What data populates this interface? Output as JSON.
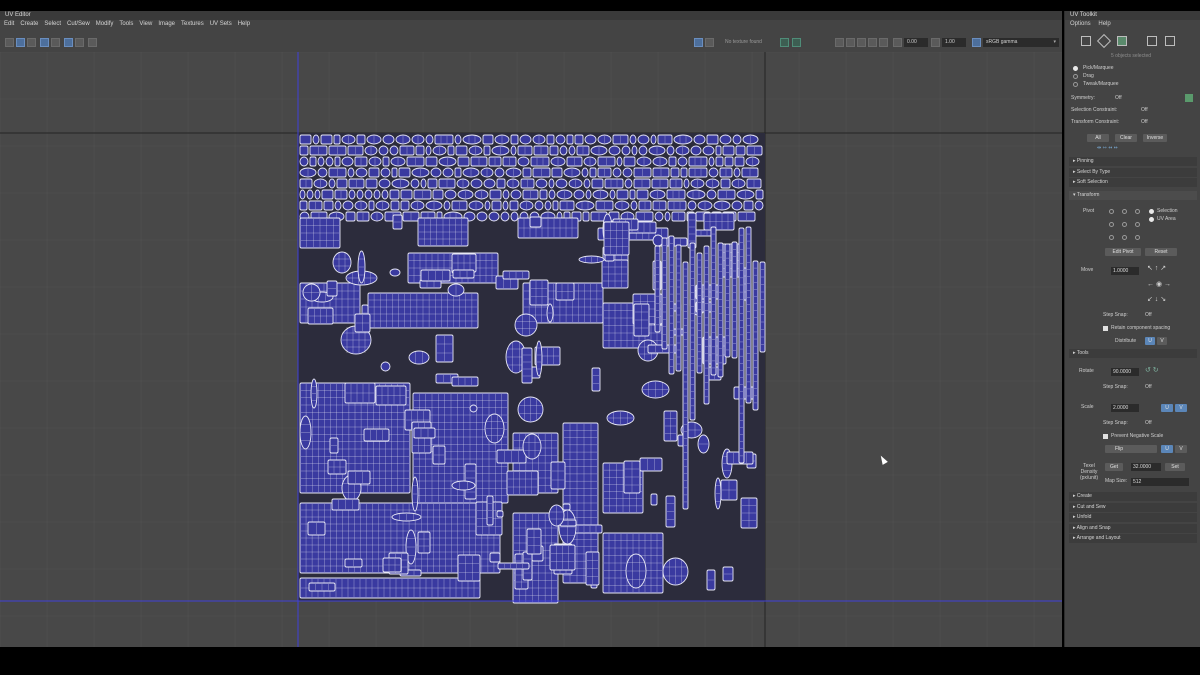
{
  "editor": {
    "title": "UV Editor",
    "menus": [
      "Edit",
      "Create",
      "Select",
      "Cut/Sew",
      "Modify",
      "Tools",
      "View",
      "Image",
      "Textures",
      "UV Sets",
      "Help"
    ],
    "toolbar": {
      "texture_status": "No texture found",
      "exposure": "0.00",
      "gamma": "1.00",
      "color_space": "sRGB gamma"
    },
    "viewport": {
      "axis_color": "#4040d8",
      "uv_fill": "#3a3aa0",
      "uv_line": "#e8e8f5"
    }
  },
  "toolkit": {
    "title": "UV Toolkit",
    "menus": [
      "Options",
      "Help"
    ],
    "objects_selected": "5 objects selected",
    "selection_modes": [
      "Pick/Marquee",
      "Drag",
      "Tweak/Marquee"
    ],
    "symmetry": {
      "label": "Symmetry:",
      "value": "Off"
    },
    "selection_constraint": {
      "label": "Selection Constraint:",
      "value": "Off"
    },
    "transform_constraint": {
      "label": "Transform Constraint:",
      "value": "Off"
    },
    "select_buttons": [
      "All",
      "Clear",
      "Inverse"
    ],
    "sections_top": [
      "Pinning",
      "Select By Type",
      "Soft Selection"
    ],
    "transform": {
      "header": "Transform",
      "pivot_label": "Pivot",
      "pivot_options": [
        "Selection",
        "UV Area"
      ],
      "edit_pivot": "Edit Pivot",
      "reset": "Reset",
      "move_label": "Move",
      "move_value": "1.0000",
      "step_snap_label": "Step Snap:",
      "step_snap_value": "Off",
      "retain_spacing": "Retain component spacing",
      "distribute": "Distribute",
      "u": "U",
      "v": "V",
      "tools": "Tools",
      "rotate_label": "Rotate",
      "rotate_value": "90.0000",
      "scale_label": "Scale",
      "scale_value": "2.0000",
      "prevent_negative": "Prevent Negative Scale",
      "flip": "Flip",
      "texel_label": "Texel Density (px/unit)",
      "get": "Get",
      "texel_value": "32.0000",
      "set": "Set",
      "map_size_label": "Map Size:",
      "map_size_value": "512"
    },
    "sections_bottom": [
      "Create",
      "Cut and Sew",
      "Unfold",
      "Align and Snap",
      "Arrange and Layout"
    ]
  }
}
